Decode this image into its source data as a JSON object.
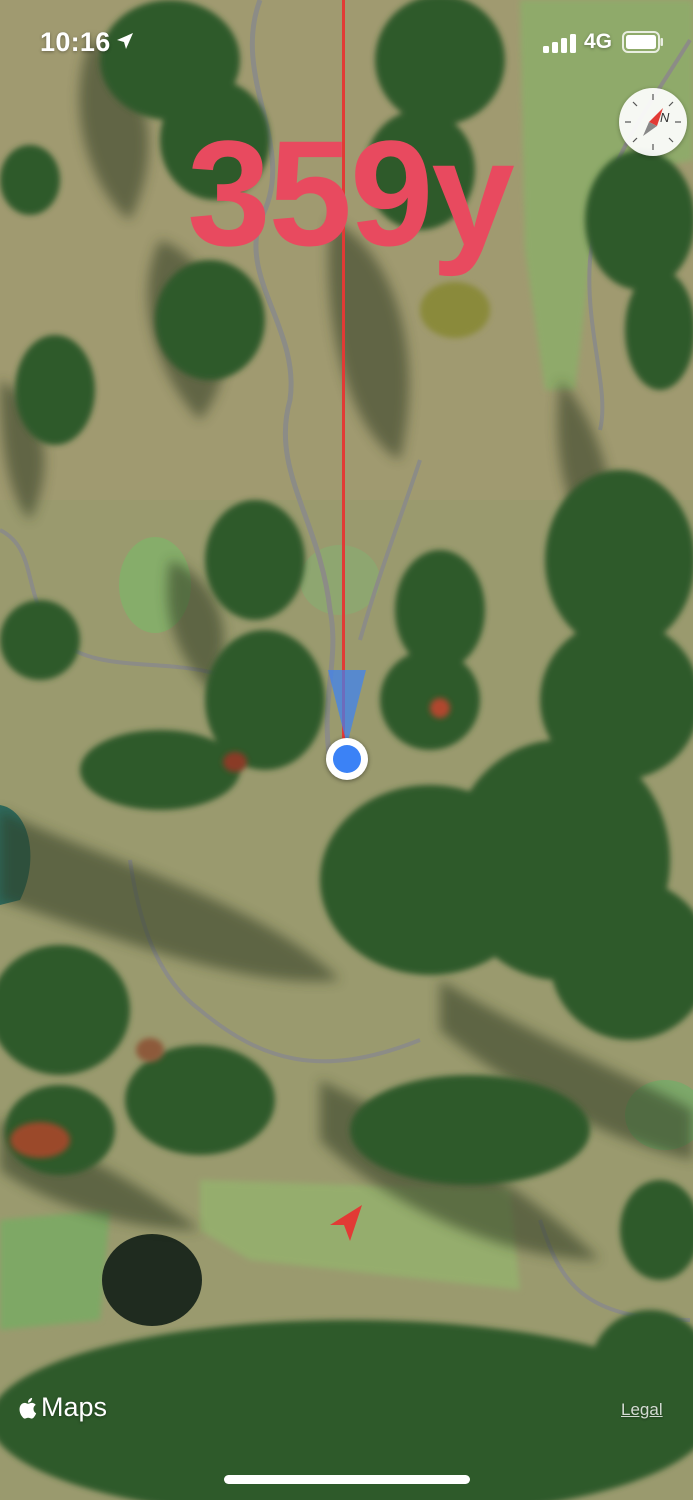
{
  "status_bar": {
    "time": "10:16",
    "network": "4G"
  },
  "distance": {
    "value": "359y",
    "color": "#e84a5f"
  },
  "compass": {
    "letter": "N"
  },
  "map": {
    "attribution": "Maps",
    "legal_label": "Legal"
  },
  "colors": {
    "aim_line": "#e23a35",
    "user_location": "#3b82f6",
    "target_marker": "#e23a35"
  },
  "icons": [
    "location-arrow-icon",
    "signal-icon",
    "battery-icon",
    "compass-icon",
    "apple-logo-icon",
    "target-marker-icon"
  ]
}
